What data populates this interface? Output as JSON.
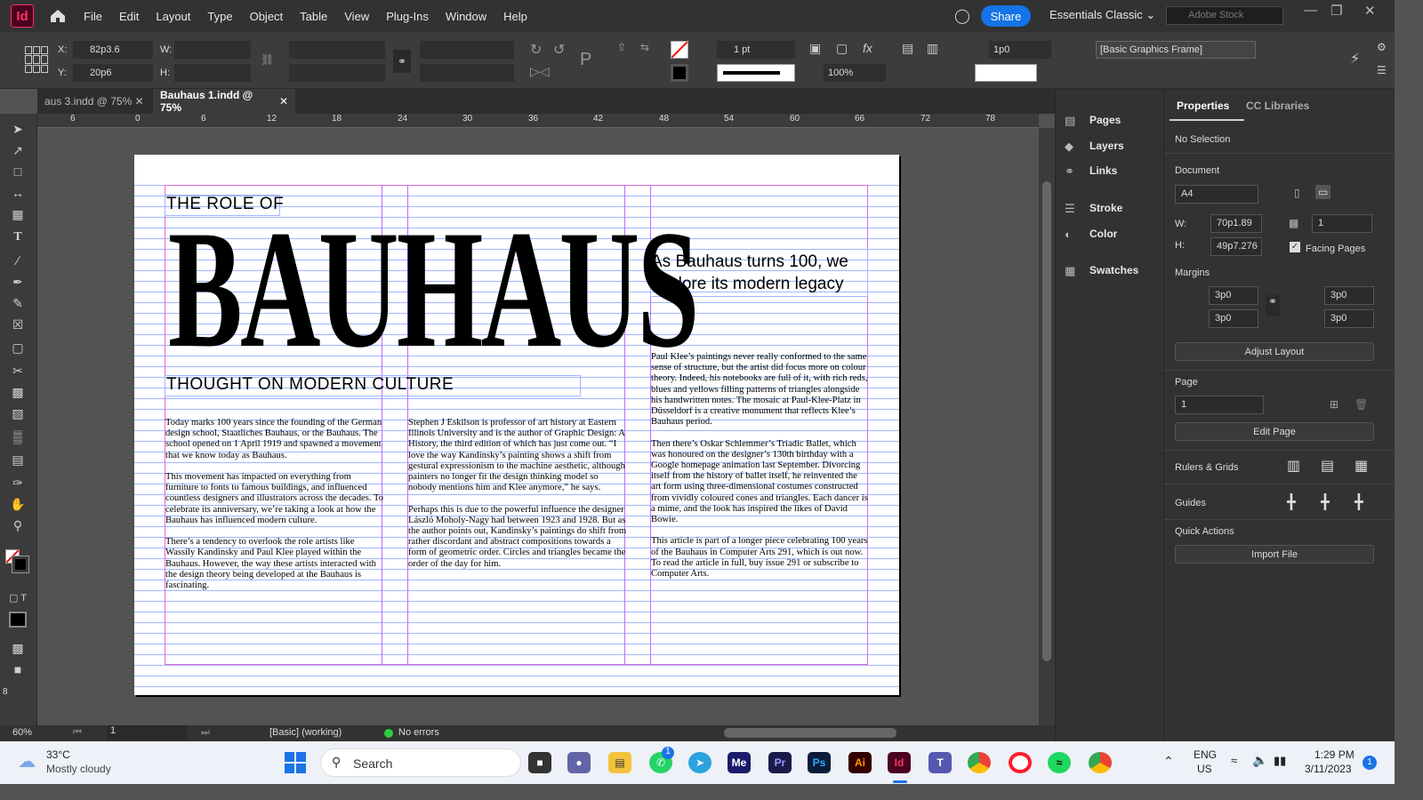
{
  "app": {
    "logo": "Id",
    "share_label": "Share",
    "workspace": "Essentials Classic",
    "stock_placeholder": "Adobe Stock"
  },
  "menu": [
    "File",
    "Edit",
    "Layout",
    "Type",
    "Object",
    "Table",
    "View",
    "Plug-Ins",
    "Window",
    "Help"
  ],
  "control": {
    "x_label": "X:",
    "x": "82p3.6",
    "y_label": "Y:",
    "y": "20p6",
    "w_label": "W:",
    "h_label": "H:",
    "stroke_weight": "1 pt",
    "scale": "100%",
    "gap": "1p0",
    "frame_style": "[Basic Graphics Frame]"
  },
  "tabs": [
    {
      "label": "aus 3.indd @ 75%"
    },
    {
      "label": "Bauhaus 1.indd @ 75%"
    }
  ],
  "ruler": [
    "6",
    "0",
    "6",
    "12",
    "18",
    "24",
    "30",
    "36",
    "42",
    "48",
    "54",
    "60",
    "66",
    "72",
    "78"
  ],
  "vruler": "8",
  "document": {
    "title_small": "THE ROLE OF",
    "headline": "BAUHAUS",
    "subtitle": "THOUGHT ON MODERN CULTURE",
    "lede": "As Bauhaus turns 100, we explore its modern legacy",
    "col1": [
      "Today marks 100 years since the founding of the German design school, Staatliches Bauhaus, or the Bauhaus. The school opened on 1 April 1919 and spawned a movement that we know today as Bauhaus.",
      "This movement has impacted on everything from furniture to fonts to famous buildings, and influenced countless designers and illustrators across the decades. To celebrate its anniversary, we’re taking a look at how the Bauhaus has influenced modern culture.",
      "There’s a tendency to overlook the role artists like Wassily Kandinsky and Paul Klee played within the Bauhaus. However, the way these artists interacted with the design theory being developed at the Bauhaus is fascinating."
    ],
    "col2": [
      "Stephen J Eskilson is professor of art history at Eastern Illinois University and is the author of Graphic Design: A History, the third edition of which has just come out. “I love the way Kandinsky’s painting shows a shift from gestural expressionism to the machine aesthetic, although painters no longer fit the design thinking model so nobody mentions him and Klee anymore,” he says.",
      "Perhaps this is due to the powerful influence the designer László Moholy-Nagy had between 1923 and 1928. But as the author points out, Kandinsky’s paintings do shift from rather discordant and abstract compositions towards a form of geometric order. Circles and triangles became the order of the day for him."
    ],
    "col3": [
      "Paul Klee’s paintings never really conformed to the same sense of structure, but the artist did focus more on colour theory. Indeed, his notebooks are full of it, with rich reds, blues and yellows filling patterns of triangles alongside his handwritten notes. The mosaic at Paul-Klee-Platz in Düsseldorf is a creative monument that reflects Klee’s Bauhaus period.",
      "Then there’s Oskar Schlemmer’s Triadic Ballet, which was honoured on the designer’s 130th birthday with a Google homepage animation last September. Divorcing itself from the history of ballet itself, he reinvented the art form using three-dimensional costumes constructed from vividly coloured cones and triangles. Each dancer is a mime, and the look has inspired the likes of David Bowie.",
      "This article is part of a longer piece celebrating 100 years of the Bauhaus in Computer Arts 291, which is out now. To read the article in full, buy issue 291 or subscribe to Computer Arts."
    ]
  },
  "status": {
    "zoom": "60%",
    "page": "1",
    "profile": "[Basic] (working)",
    "preflight": "No errors"
  },
  "panels": [
    "Pages",
    "Layers",
    "Links",
    "Stroke",
    "Color",
    "Swatches"
  ],
  "properties": {
    "tab_active": "Properties",
    "tab2": "CC Libraries",
    "selection": "No Selection",
    "document_label": "Document",
    "preset": "A4",
    "w_label": "W:",
    "w": "70p1.89",
    "h_label": "H:",
    "h": "49p7.276",
    "pages_count": "1",
    "facing_pages": "Facing Pages",
    "margins_label": "Margins",
    "m_top": "3p0",
    "m_bottom": "3p0",
    "m_left": "3p0",
    "m_right": "3p0",
    "adjust_layout": "Adjust Layout",
    "page_label": "Page",
    "page": "1",
    "edit_page": "Edit Page",
    "rulers_grids": "Rulers & Grids",
    "guides": "Guides",
    "quick_actions": "Quick Actions",
    "import_file": "Import File"
  },
  "taskbar": {
    "weather_temp": "33°C",
    "weather_desc": "Mostly cloudy",
    "search": "Search",
    "lang1": "ENG",
    "lang2": "US",
    "time": "1:29 PM",
    "date": "3/11/2023",
    "notif": "1",
    "whatsapp_badge": "1",
    "apps": [
      "Me",
      "Pr",
      "Ps",
      "Ai",
      "Id"
    ]
  },
  "colors": {
    "accent": "#1473e6",
    "indesign": "#ff3366",
    "guide_h": "#9fb7ff",
    "guide_v": "#c06bff",
    "margin": "#e06bd6"
  }
}
